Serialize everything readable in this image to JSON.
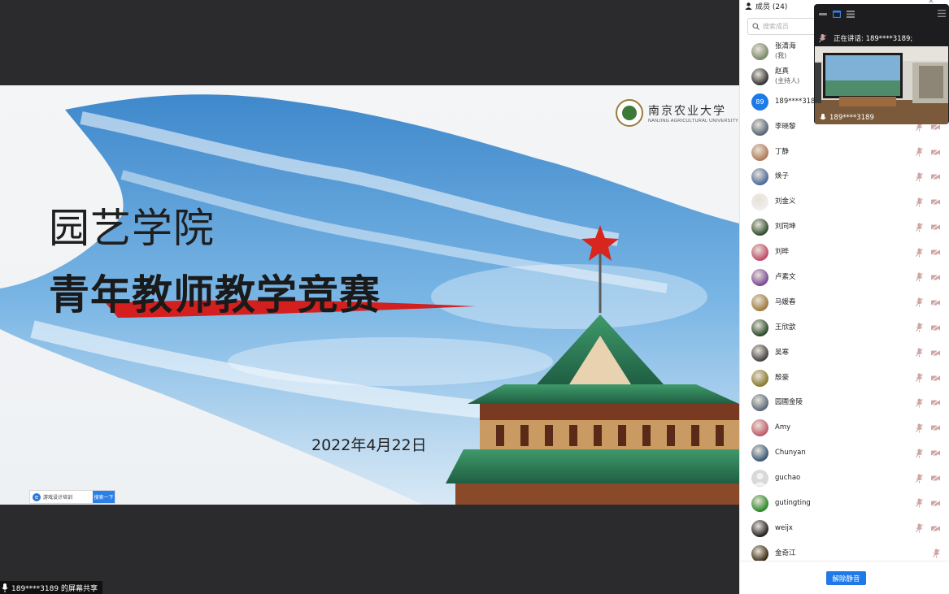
{
  "presentation": {
    "subtitle": "园艺学院",
    "title": "青年教师教学竞赛",
    "date": "2022年4月22日",
    "university_cn": "南京农业大学",
    "university_en": "NANJING AGRICULTURAL UNIVERSITY",
    "search_widget": {
      "text": "游戏设计培训",
      "button": "搜索一下"
    }
  },
  "share_status": "189****3189 的屏幕共享",
  "member_panel": {
    "header": "成员 (24)",
    "close_symbol": "×",
    "search_placeholder": "搜索成员",
    "unmute_all_label": "解除静音",
    "members": [
      {
        "name": "张清海",
        "role": "(我)",
        "avatar": "photo",
        "icons": false
      },
      {
        "name": "赵真",
        "role": "(主持人)",
        "avatar": "photo",
        "icons": false
      },
      {
        "name": "189****3189",
        "role": "",
        "avatar": "89",
        "icons": false
      },
      {
        "name": "李晓黎",
        "role": "",
        "avatar": "photo",
        "icons": true
      },
      {
        "name": "丁静",
        "role": "",
        "avatar": "photo",
        "icons": true
      },
      {
        "name": "焕子",
        "role": "",
        "avatar": "photo",
        "icons": true
      },
      {
        "name": "刘金义",
        "role": "",
        "avatar": "photo",
        "icons": true
      },
      {
        "name": "刘同坤",
        "role": "",
        "avatar": "photo",
        "icons": true
      },
      {
        "name": "刘晔",
        "role": "",
        "avatar": "photo",
        "icons": true
      },
      {
        "name": "卢素文",
        "role": "",
        "avatar": "photo",
        "icons": true
      },
      {
        "name": "马媛春",
        "role": "",
        "avatar": "photo",
        "icons": true
      },
      {
        "name": "王欣歆",
        "role": "",
        "avatar": "photo",
        "icons": true
      },
      {
        "name": "吴寒",
        "role": "",
        "avatar": "photo",
        "icons": true
      },
      {
        "name": "殷豪",
        "role": "",
        "avatar": "photo",
        "icons": true
      },
      {
        "name": "园圃金陵",
        "role": "",
        "avatar": "photo",
        "icons": true
      },
      {
        "name": "Amy",
        "role": "",
        "avatar": "photo",
        "icons": true
      },
      {
        "name": "Chunyan",
        "role": "",
        "avatar": "photo",
        "icons": true
      },
      {
        "name": "guchao",
        "role": "",
        "avatar": "default",
        "icons": true
      },
      {
        "name": "gutingting",
        "role": "",
        "avatar": "photo",
        "icons": true
      },
      {
        "name": "weijx",
        "role": "",
        "avatar": "photo",
        "icons": true
      },
      {
        "name": "金奇江",
        "role": "",
        "avatar": "photo",
        "icons": "mic-only"
      }
    ]
  },
  "video_window": {
    "speaking_label": "正在讲话: 189****3189;",
    "participant_name": "189****3189"
  },
  "colors": {
    "accent_blue": "#1f7ae8",
    "background_dark": "#2b2b2e",
    "muted_icon": "#c9a3a3"
  }
}
